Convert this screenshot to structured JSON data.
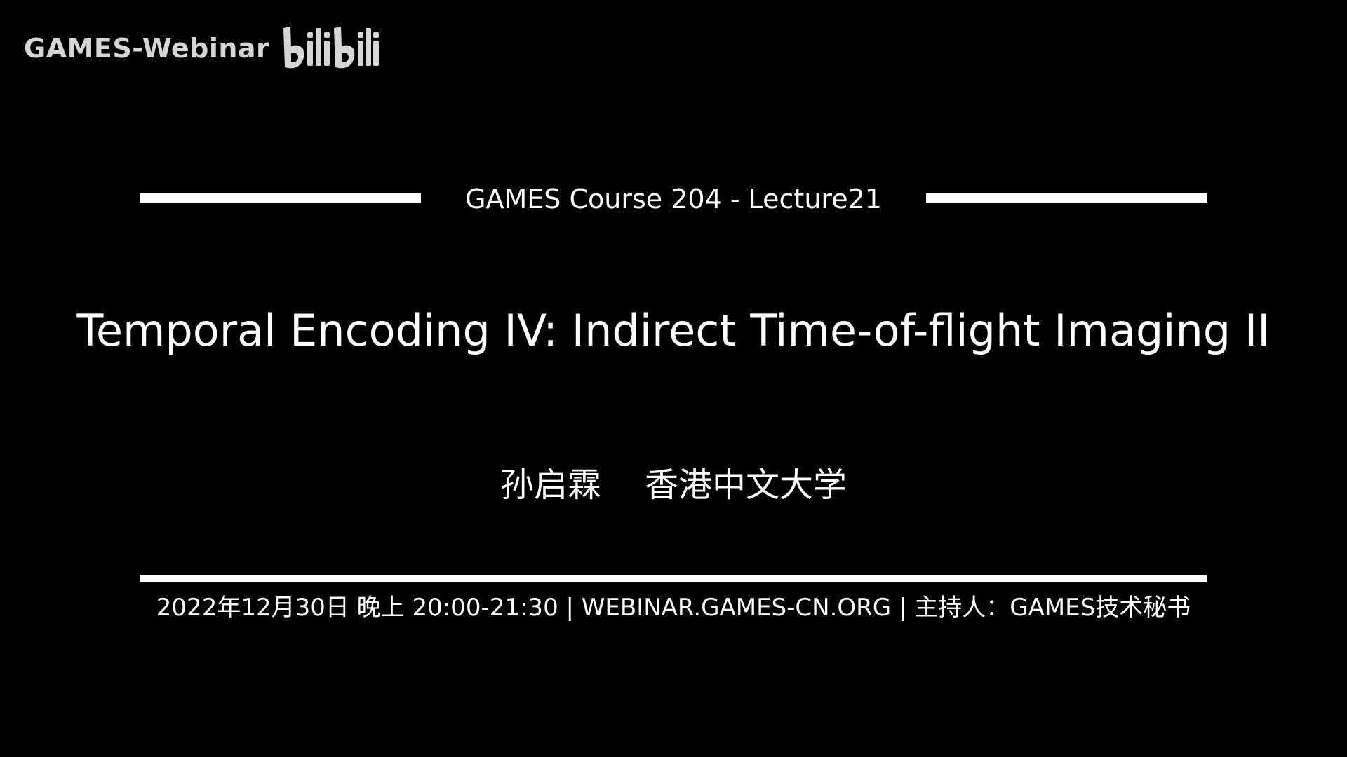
{
  "watermark": {
    "text": "GAMES-Webinar",
    "logo_text": "bilibili",
    "color": "#d6d6d6"
  },
  "slide": {
    "course": "GAMES Course 204 - Lecture21",
    "title": "Temporal Encoding IV: Indirect Time-of-flight Imaging II",
    "presenter_name": "孙启霖",
    "presenter_affiliation": "香港中文大学",
    "info": "2022年12月30日 晚上 20:00-21:30 | WEBINAR.GAMES-CN.ORG | 主持人：GAMES技术秘书"
  },
  "colors": {
    "background": "#000000",
    "foreground": "#ffffff"
  }
}
